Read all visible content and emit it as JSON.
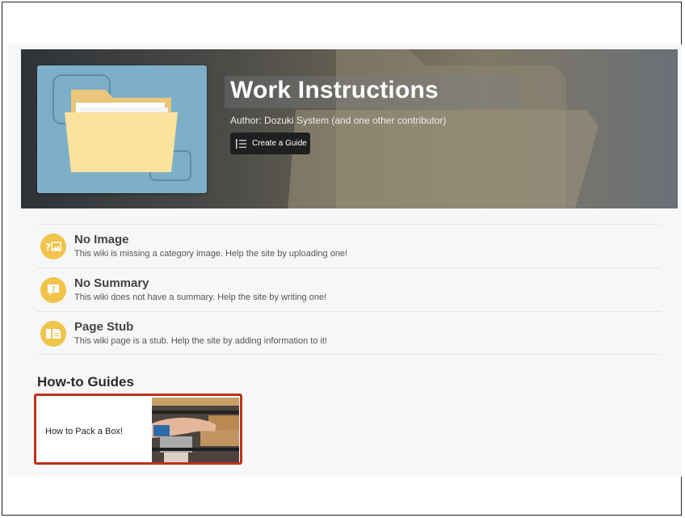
{
  "hero": {
    "title": "Work Instructions",
    "author": "Author: Dozuki System (and one other contributor)",
    "create_button_label": "Create a Guide"
  },
  "notices": [
    {
      "icon": "no-image-icon",
      "title": "No Image",
      "text": "This wiki is missing a category image. Help the site by uploading one!"
    },
    {
      "icon": "no-summary-icon",
      "title": "No Summary",
      "text": "This wiki does not have a summary. Help the site by writing one!"
    },
    {
      "icon": "page-stub-icon",
      "title": "Page Stub",
      "text": "This wiki page is a stub. Help the site by adding information to it!"
    }
  ],
  "guides_section": {
    "title": "How-to Guides",
    "guides": [
      {
        "title": "How to Pack a Box!"
      }
    ]
  },
  "colors": {
    "badge": "#f0c44a",
    "card_highlight": "#c0311a",
    "button_bg": "#1e1f21",
    "thumb_bg": "#7db0c8"
  }
}
